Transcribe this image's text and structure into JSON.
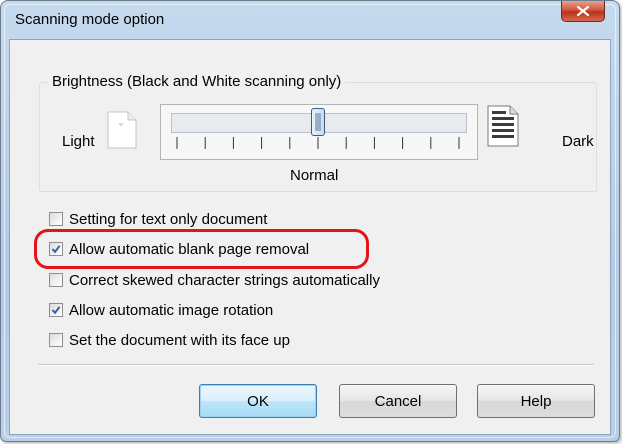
{
  "window": {
    "title": "Scanning mode option",
    "close_icon": "close-x-icon"
  },
  "brightness": {
    "legend": "Brightness (Black and White scanning only)",
    "left_label": "Light",
    "right_label": "Dark",
    "center_label": "Normal",
    "slider_value_fraction": 0.5,
    "tick_count": 11
  },
  "options": [
    {
      "label": "Setting for text only document",
      "checked": false
    },
    {
      "label": "Allow automatic blank page removal",
      "checked": true
    },
    {
      "label": "Correct skewed character strings automatically",
      "checked": false
    },
    {
      "label": "Allow automatic image rotation",
      "checked": true
    },
    {
      "label": "Set the document with its face up",
      "checked": false
    }
  ],
  "buttons": {
    "ok": "OK",
    "cancel": "Cancel",
    "help": "Help"
  },
  "colors": {
    "highlight": "#e2141c",
    "check": "#3a5fa0"
  }
}
